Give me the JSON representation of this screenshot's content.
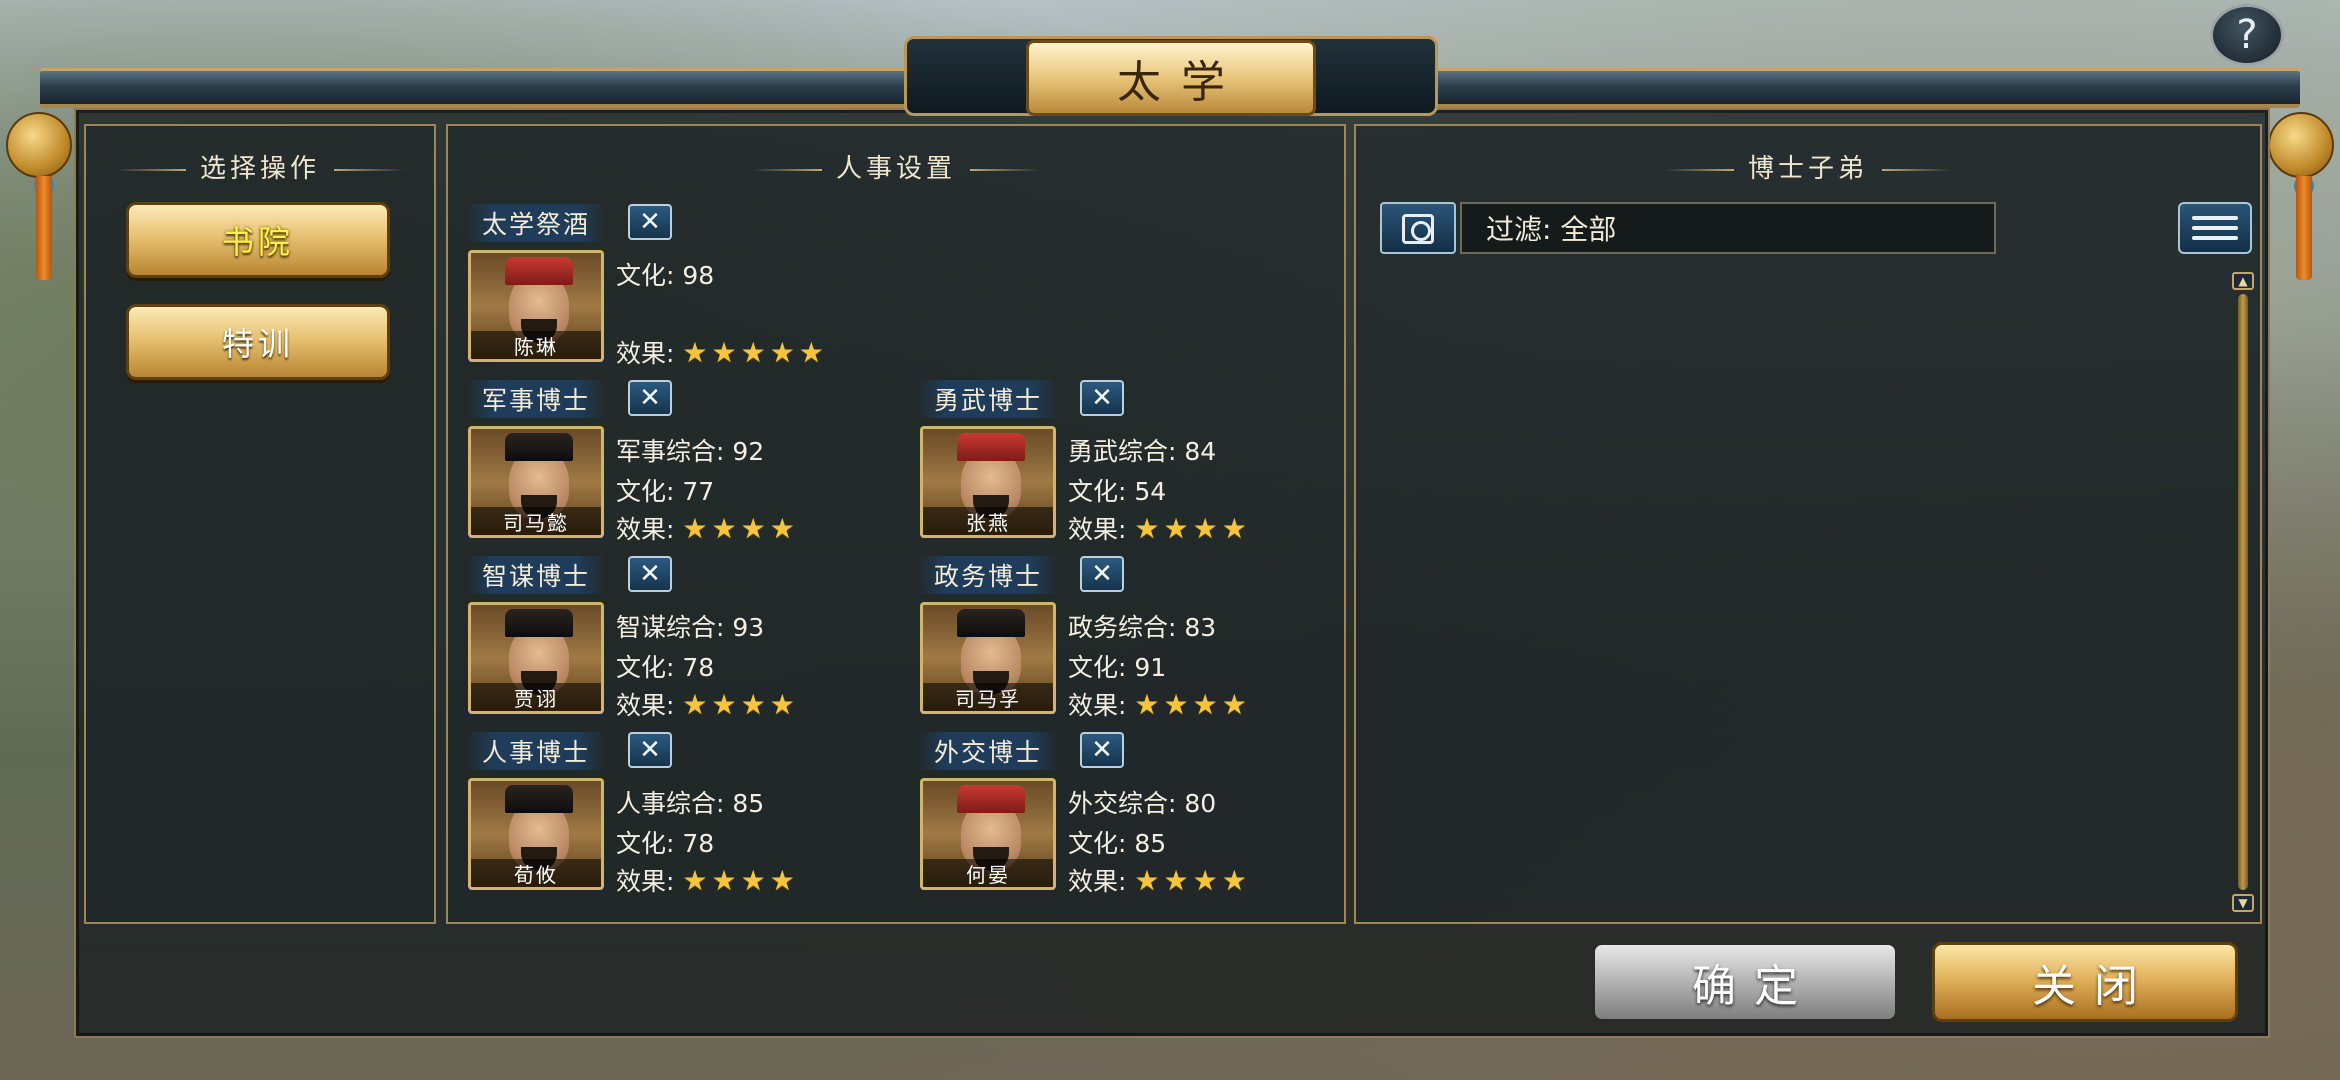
{
  "window": {
    "title": "太学",
    "help_label": "?"
  },
  "left_panel": {
    "title": "选择操作",
    "buttons": [
      {
        "label": "书院",
        "active": true
      },
      {
        "label": "特训",
        "active": false
      }
    ]
  },
  "middle_panel": {
    "title": "人事设置",
    "slots": [
      {
        "role": "太学祭酒",
        "name": "陈琳",
        "stats": [
          "文化: 98"
        ],
        "effect_label": "效果:",
        "stars": 5
      },
      {
        "role": "军事博士",
        "name": "司马懿",
        "stats": [
          "军事综合: 92",
          "文化: 77"
        ],
        "effect_label": "效果:",
        "stars": 4
      },
      {
        "role": "勇武博士",
        "name": "张燕",
        "stats": [
          "勇武综合: 84",
          "文化: 54"
        ],
        "effect_label": "效果:",
        "stars": 4
      },
      {
        "role": "智谋博士",
        "name": "贾诩",
        "stats": [
          "智谋综合: 93",
          "文化: 78"
        ],
        "effect_label": "效果:",
        "stars": 4
      },
      {
        "role": "政务博士",
        "name": "司马孚",
        "stats": [
          "政务综合: 83",
          "文化: 91"
        ],
        "effect_label": "效果:",
        "stars": 4
      },
      {
        "role": "人事博士",
        "name": "荀攸",
        "stats": [
          "人事综合: 85",
          "文化: 78"
        ],
        "effect_label": "效果:",
        "stars": 4
      },
      {
        "role": "外交博士",
        "name": "何晏",
        "stats": [
          "外交综合: 80",
          "文化: 85"
        ],
        "effect_label": "效果:",
        "stars": 4
      }
    ],
    "remove_glyph": "✕",
    "star_glyph": "★"
  },
  "right_panel": {
    "title": "博士子弟",
    "filter_text": "过滤:  全部"
  },
  "footer": {
    "confirm_label": "确定",
    "close_label": "关闭"
  },
  "colors": {
    "accent_gold": "#e8c171",
    "active_text": "#fff14a",
    "panel_bg": "#161c1e"
  }
}
